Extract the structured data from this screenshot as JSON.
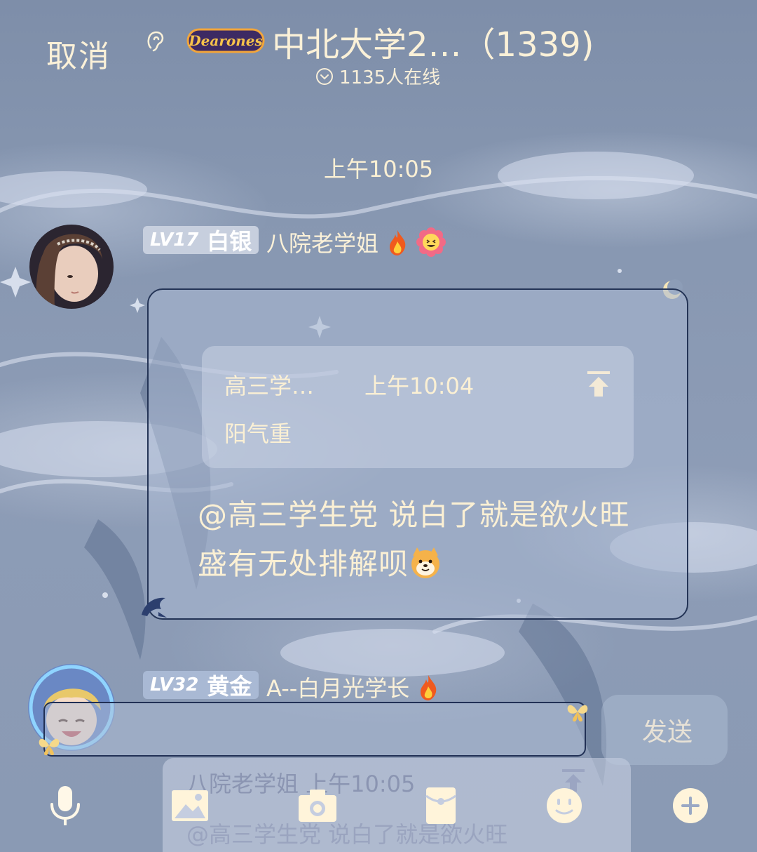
{
  "header": {
    "cancel_label": "取消",
    "group_title": "中北大学2…（1339)",
    "online_text": "1135人在线",
    "logo_text": "Dearones"
  },
  "timestamp": "上午10:05",
  "message1": {
    "level": "LV17",
    "rank": "白银",
    "nickname": "八院老学姐",
    "quote": {
      "name": "高三学…",
      "time": "上午10:04",
      "text": "阳气重"
    },
    "text": "@高三学生党 说白了就是欲火旺盛有无处排解呗"
  },
  "message2": {
    "level": "LV32",
    "rank": "黄金",
    "nickname": "A--白月光学长"
  },
  "composer": {
    "send_label": "发送",
    "reply_meta": "八院老学姐 上午10:05",
    "reply_text": "@高三学生党 说白了就是欲火旺"
  },
  "toolbar": {
    "icons": [
      "microphone-icon",
      "image-icon",
      "camera-icon",
      "red-packet-icon",
      "emoji-icon",
      "plus-icon"
    ]
  },
  "colors": {
    "text": "#fbf0d4",
    "bubble_border": "#243456",
    "background": "#8d9db7"
  }
}
